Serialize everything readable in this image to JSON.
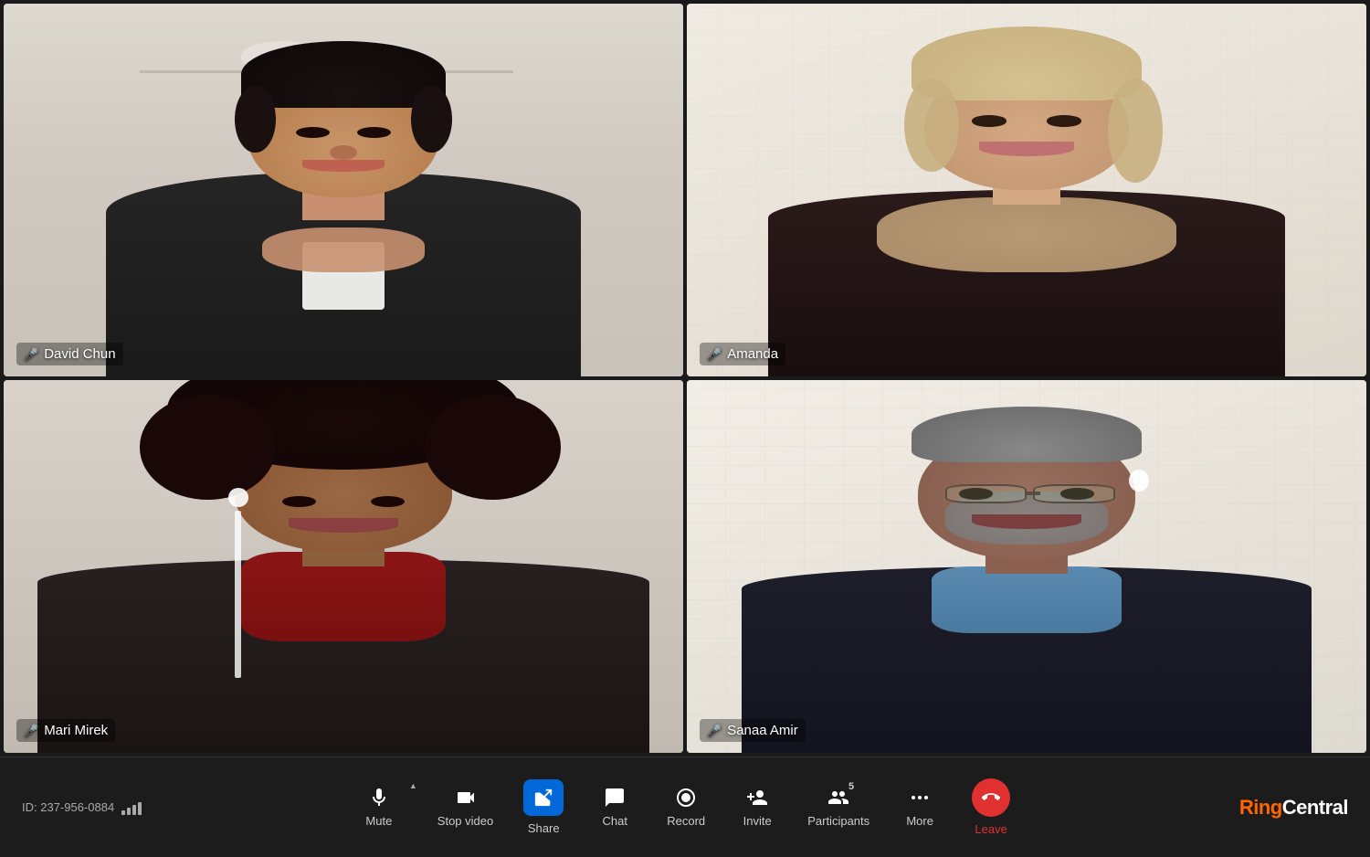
{
  "participants": [
    {
      "id": "david-chun",
      "name": "David Chun",
      "micActive": true,
      "isSpeaking": true,
      "position": "top-left"
    },
    {
      "id": "amanda",
      "name": "Amanda",
      "micActive": false,
      "isSpeaking": false,
      "position": "top-right"
    },
    {
      "id": "mari-mirek",
      "name": "Mari Mirek",
      "micActive": true,
      "isSpeaking": false,
      "position": "bottom-left"
    },
    {
      "id": "sanaa-amir",
      "name": "Sanaa Amir",
      "micActive": true,
      "isSpeaking": false,
      "position": "bottom-right"
    }
  ],
  "toolbar": {
    "meetingId": "ID: 237-956-0884",
    "buttons": [
      {
        "id": "mute",
        "label": "Mute",
        "hasCaret": true
      },
      {
        "id": "stop-video",
        "label": "Stop video"
      },
      {
        "id": "share",
        "label": "Share",
        "highlighted": true
      },
      {
        "id": "chat",
        "label": "Chat"
      },
      {
        "id": "record",
        "label": "Record"
      },
      {
        "id": "invite",
        "label": "Invite"
      },
      {
        "id": "participants",
        "label": "Participants",
        "badge": "5"
      },
      {
        "id": "more",
        "label": "More"
      },
      {
        "id": "leave",
        "label": "Leave",
        "isLeave": true
      }
    ]
  },
  "brand": {
    "name": "RingCentral",
    "prefix": "Ring",
    "suffix": "Central"
  },
  "colors": {
    "activeSpeaker": "#00cc44",
    "toolbar": "#1c1c1c",
    "shareHighlight": "#0068d9",
    "leaveRed": "#e03030",
    "brandOrange": "#ff6600"
  }
}
